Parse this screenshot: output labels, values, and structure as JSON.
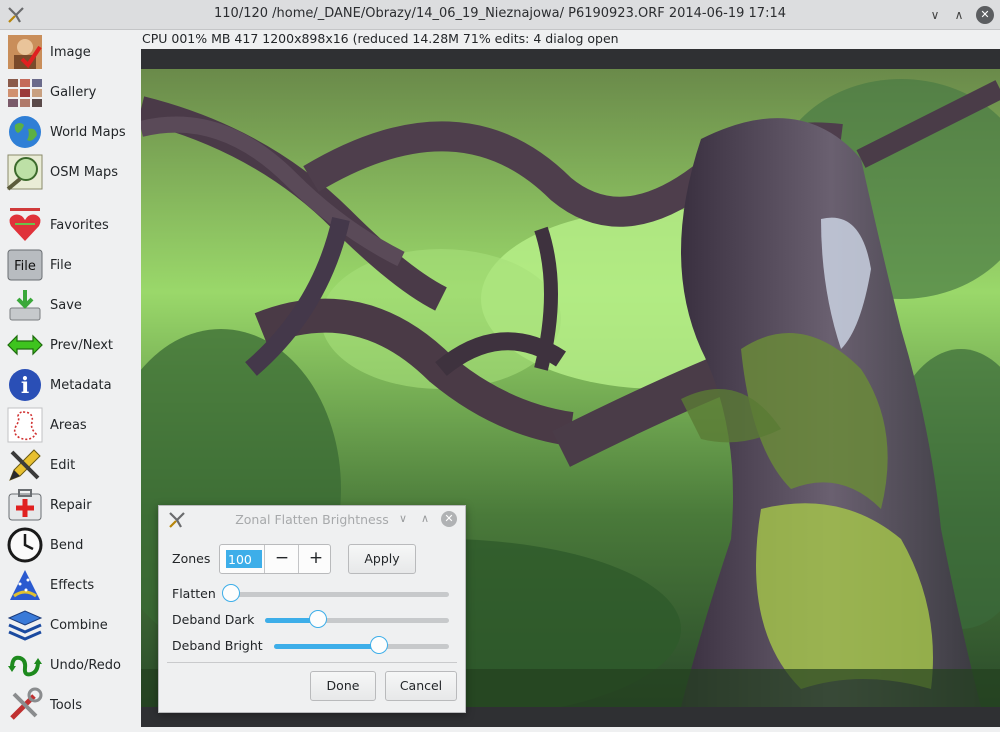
{
  "window": {
    "title": "110/120  /home/_DANE/Obrazy/14_06_19_Nieznajowa/  P6190923.ORF  2014-06-19 17:14",
    "icon": "fotoxx-app-icon",
    "controls": {
      "minimize": "∨",
      "maximize": "∧",
      "close": "✕"
    }
  },
  "status_line": "CPU 001%  MB 417  1200x898x16 (reduced  14.28M  71%  edits: 4  dialog open",
  "sidebar": {
    "items": [
      {
        "label": "Image",
        "icon": "image-icon"
      },
      {
        "label": "Gallery",
        "icon": "gallery-icon"
      },
      {
        "label": "World Maps",
        "icon": "globe-icon"
      },
      {
        "label": "OSM Maps",
        "icon": "osm-map-icon"
      },
      {
        "label": "Favorites",
        "icon": "heart-icon"
      },
      {
        "label": "File",
        "icon": "file-icon",
        "icon_text": "File"
      },
      {
        "label": "Save",
        "icon": "save-icon"
      },
      {
        "label": "Prev/Next",
        "icon": "arrows-icon"
      },
      {
        "label": "Metadata",
        "icon": "info-icon",
        "icon_text": "i"
      },
      {
        "label": "Areas",
        "icon": "areas-icon"
      },
      {
        "label": "Edit",
        "icon": "edit-icon"
      },
      {
        "label": "Repair",
        "icon": "repair-icon"
      },
      {
        "label": "Bend",
        "icon": "bend-icon"
      },
      {
        "label": "Effects",
        "icon": "effects-icon"
      },
      {
        "label": "Combine",
        "icon": "combine-icon"
      },
      {
        "label": "Undo/Redo",
        "icon": "undo-redo-icon"
      },
      {
        "label": "Tools",
        "icon": "tools-icon"
      }
    ]
  },
  "dialog": {
    "title": "Zonal Flatten Brightness",
    "controls": {
      "minimize": "∨",
      "maximize": "∧",
      "close": "✕"
    },
    "zones_label": "Zones",
    "zones_value": "100",
    "minus_label": "−",
    "plus_label": "+",
    "apply_label": "Apply",
    "sliders": [
      {
        "label": "Flatten",
        "value": 0.0
      },
      {
        "label": "Deband Dark",
        "value": 0.29
      },
      {
        "label": "Deband Bright",
        "value": 0.6
      }
    ],
    "done_label": "Done",
    "cancel_label": "Cancel"
  },
  "colors": {
    "accent": "#3daee9",
    "window_bg": "#eff0f1",
    "image_frame": "#2f3033"
  }
}
